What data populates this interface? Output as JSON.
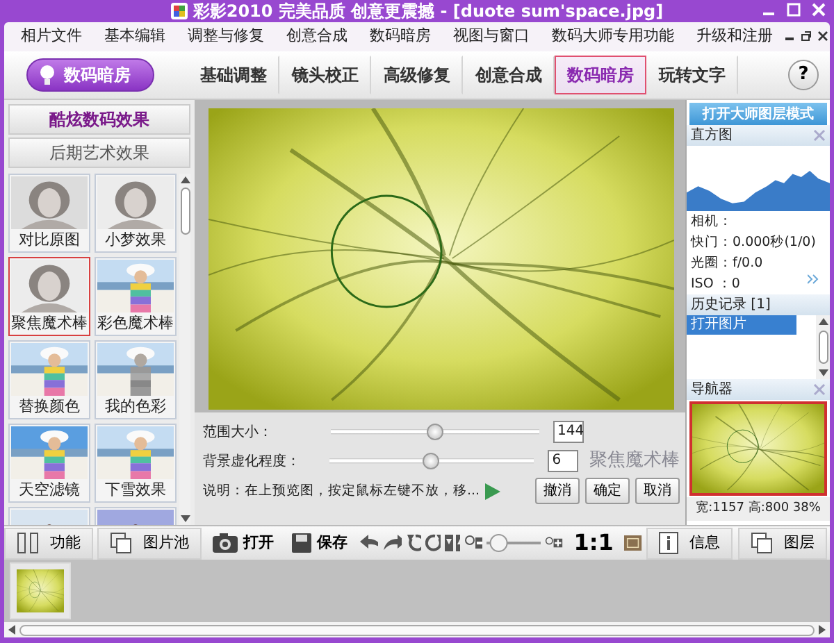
{
  "window": {
    "title": "彩影2010 完美品质 创意更震撼 - [duote sum'space.jpg]"
  },
  "menu": [
    "相片文件",
    "基本编辑",
    "调整与修复",
    "创意合成",
    "数码暗房",
    "视图与窗口",
    "数码大师专用功能",
    "升级和注册"
  ],
  "mode_button": {
    "label": "数码暗房"
  },
  "tabs": [
    {
      "label": "基础调整",
      "selected": false
    },
    {
      "label": "镜头校正",
      "selected": false
    },
    {
      "label": "高级修复",
      "selected": false
    },
    {
      "label": "创意合成",
      "selected": false
    },
    {
      "label": "数码暗房",
      "selected": true
    },
    {
      "label": "玩转文字",
      "selected": false
    }
  ],
  "help": {
    "label": "?"
  },
  "effect_categories": [
    {
      "label": "酷炫数码效果",
      "selected": true
    },
    {
      "label": "后期艺术效果",
      "selected": false
    }
  ],
  "effects": [
    {
      "label": "对比原图",
      "selected": false
    },
    {
      "label": "小梦效果",
      "selected": false
    },
    {
      "label": "聚焦魔术棒",
      "selected": true
    },
    {
      "label": "彩色魔术棒",
      "selected": false
    },
    {
      "label": "替换颜色",
      "selected": false
    },
    {
      "label": "我的色彩",
      "selected": false
    },
    {
      "label": "天空滤镜",
      "selected": false
    },
    {
      "label": "下雪效果",
      "selected": false
    },
    {
      "selected": false
    },
    {
      "selected": false
    }
  ],
  "controls": {
    "sliders": [
      {
        "label": "范围大小：",
        "level": 0.5,
        "value": "144"
      },
      {
        "label": "背景虚化程度：",
        "level": 0.5,
        "value": "6"
      }
    ],
    "effect_name": "聚焦魔术棒",
    "note": "说明：在上预览图，按定鼠标左键不放，移...",
    "buttons": [
      "撤消",
      "确定",
      "取消"
    ]
  },
  "right_panel": {
    "layer_mode_button": "打开大师图层模式",
    "histogram_title": "直方图",
    "camera_info": [
      "相机：",
      "快门：0.000秒(1/0)",
      "光圈：f/0.0",
      "ISO ：0"
    ],
    "history_title": "历史记录 [1]",
    "history": [
      {
        "label": "打开图片",
        "selected": true
      }
    ],
    "navigator_title": "导航器",
    "image_size": "宽:1157 高:800 38%"
  },
  "bottom_toolbar": {
    "panel_tabs": [
      "功能",
      "图片池"
    ],
    "buttons": [
      "打开",
      "保存"
    ],
    "zoom_slider": {
      "level": 0.05
    },
    "zoom_label": "1:1",
    "side_buttons": [
      "信息",
      "图层"
    ]
  }
}
